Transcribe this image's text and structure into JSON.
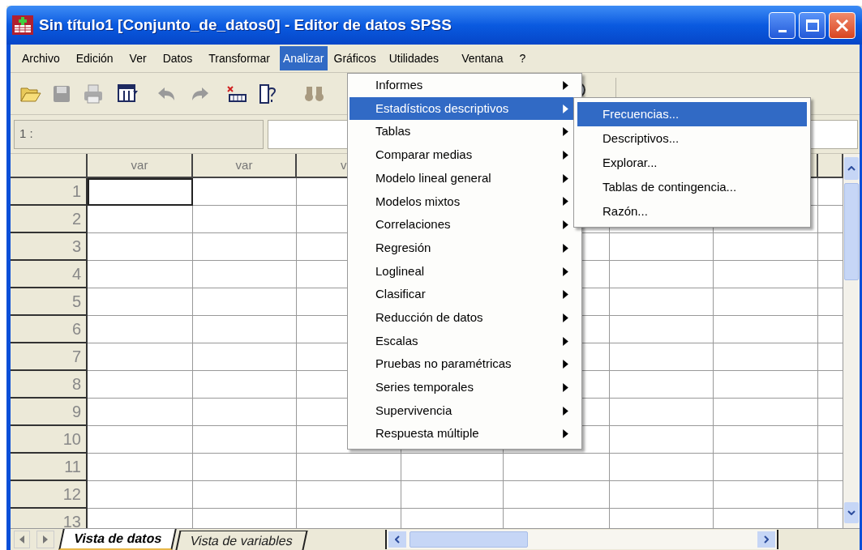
{
  "window": {
    "title": "Sin título1 [Conjunto_de_datos0] - Editor de datos SPSS"
  },
  "menu_bar": [
    {
      "label": "Archivo",
      "selected": false
    },
    {
      "label": "Edición",
      "selected": false
    },
    {
      "label": "Ver",
      "selected": false
    },
    {
      "label": "Datos",
      "selected": false
    },
    {
      "label": "Transformar",
      "selected": false
    },
    {
      "label": "Analizar",
      "selected": true
    },
    {
      "label": "Gráficos",
      "selected": false
    },
    {
      "label": "Utilidades",
      "selected": false
    },
    {
      "label": "Ventana",
      "selected": false
    },
    {
      "label": "?",
      "selected": false
    }
  ],
  "cell_editor": {
    "label": "1 :"
  },
  "grid": {
    "columns": [
      "var",
      "var",
      "v"
    ],
    "rows": [
      {
        "label": "1",
        "selected": true
      },
      {
        "label": "2",
        "selected": false
      },
      {
        "label": "3",
        "selected": false
      },
      {
        "label": "4",
        "selected": false
      },
      {
        "label": "5",
        "selected": false
      },
      {
        "label": "6",
        "selected": false
      },
      {
        "label": "7",
        "selected": false
      },
      {
        "label": "8",
        "selected": false
      },
      {
        "label": "9",
        "selected": false
      },
      {
        "label": "10",
        "selected": false
      },
      {
        "label": "11",
        "selected": false
      },
      {
        "label": "12",
        "selected": false
      },
      {
        "label": "13",
        "selected": false
      }
    ]
  },
  "analyze_menu": {
    "items": [
      {
        "label": "Informes",
        "selected": false,
        "has_submenu": true
      },
      {
        "label": "Estadísticos descriptivos",
        "selected": true,
        "has_submenu": true
      },
      {
        "label": "Tablas",
        "selected": false,
        "has_submenu": true
      },
      {
        "label": "Comparar medias",
        "selected": false,
        "has_submenu": true
      },
      {
        "label": "Modelo lineal general",
        "selected": false,
        "has_submenu": true
      },
      {
        "label": "Modelos mixtos",
        "selected": false,
        "has_submenu": true
      },
      {
        "label": "Correlaciones",
        "selected": false,
        "has_submenu": true
      },
      {
        "label": "Regresión",
        "selected": false,
        "has_submenu": true
      },
      {
        "label": "Loglineal",
        "selected": false,
        "has_submenu": true
      },
      {
        "label": "Clasificar",
        "selected": false,
        "has_submenu": true
      },
      {
        "label": "Reducción de datos",
        "selected": false,
        "has_submenu": true
      },
      {
        "label": "Escalas",
        "selected": false,
        "has_submenu": true
      },
      {
        "label": "Pruebas no paramétricas",
        "selected": false,
        "has_submenu": true
      },
      {
        "label": "Series temporales",
        "selected": false,
        "has_submenu": true
      },
      {
        "label": "Supervivencia",
        "selected": false,
        "has_submenu": true
      },
      {
        "label": "Respuesta múltiple",
        "selected": false,
        "has_submenu": true
      }
    ]
  },
  "descriptives_submenu": {
    "items": [
      {
        "label": "Frecuencias...",
        "selected": true
      },
      {
        "label": "Descriptivos...",
        "selected": false
      },
      {
        "label": "Explorar...",
        "selected": false
      },
      {
        "label": "Tablas de contingencia...",
        "selected": false
      },
      {
        "label": "Razón...",
        "selected": false
      }
    ]
  },
  "sheet_tabs": [
    {
      "label": "Vista de datos",
      "selected": true
    },
    {
      "label": "Vista de variables",
      "selected": false
    }
  ]
}
